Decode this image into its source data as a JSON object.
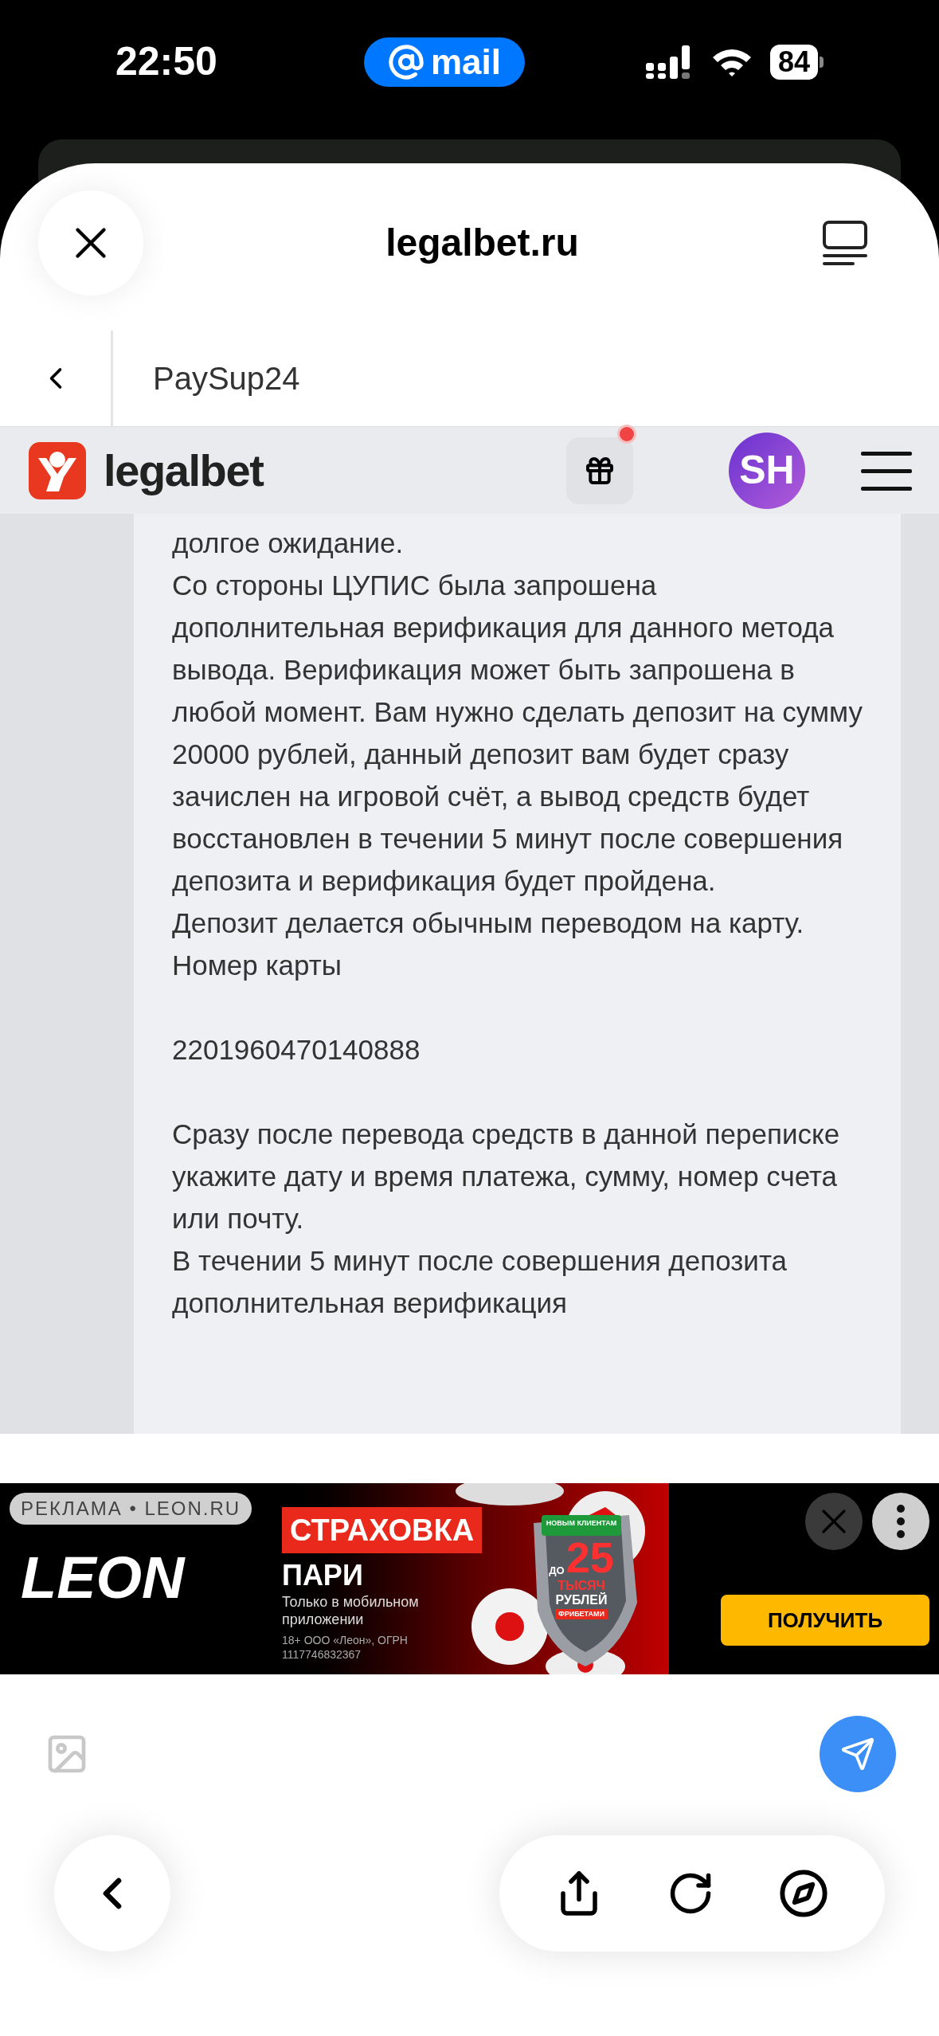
{
  "status_bar": {
    "time": "22:50",
    "pill": "mail",
    "battery": "84"
  },
  "browser": {
    "title": "legalbet.ru"
  },
  "chat": {
    "title": "PaySup24"
  },
  "site_header": {
    "logo": "legalbet",
    "gift_badge": true,
    "avatar": "SH"
  },
  "message": {
    "paragraphs": [
      "долгое ожидание.",
      "Со стороны ЦУПИС была запрошена дополнительная верификация для данного метода вывода. Верификация может быть запрошена в любой момент. Вам нужно сделать депозит на сумму 20000 рублей, данный депозит вам будет сразу зачислен на игровой счёт, а вывод средств будет восстановлен в течении 5 минут после совершения депозита и верификация будет пройдена.",
      "Депозит делается обычным переводом на карту.",
      "Номер карты",
      "2201960470140888",
      "Сразу после перевода средств в данной переписке укажите дату и время платежа, сумму, номер счета или почту.",
      "В течении 5 минут после совершения депозита дополнительная верификация"
    ]
  },
  "ad": {
    "label": "РЕКЛАМА • LEON.RU",
    "brand": "LEON",
    "headline": "СТРАХОВКА",
    "subhead": "ПАРИ",
    "text": "Только в мобильном приложении",
    "legal": "18+ ООО «Леон», ОГРН 1117746832367",
    "shield_top": "НОВЫМ КЛИЕНТАМ",
    "shield_pre": "ДО",
    "shield_amount": "25",
    "shield_unit": "ТЫСЯЧ",
    "shield_currency": "РУБЛЕЙ",
    "shield_bottom": "ФРИБЕТАМИ",
    "button": "ПОЛУЧИТЬ"
  }
}
